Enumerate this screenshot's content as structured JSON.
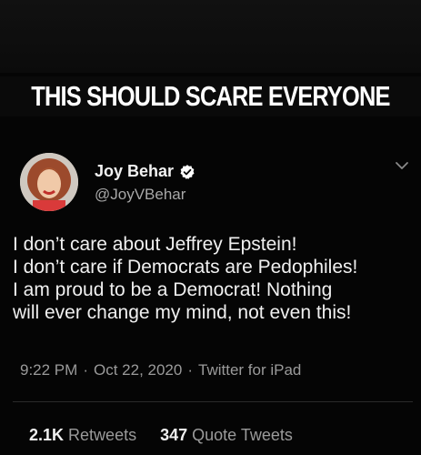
{
  "banner": {
    "text": "THIS SHOULD SCARE EVERYONE"
  },
  "tweet": {
    "display_name": "Joy Behar",
    "handle": "@JoyVBehar",
    "verified_icon": "verified-badge-icon",
    "menu_icon": "chevron-down-icon",
    "lines": [
      "I don’t care about Jeffrey Epstein!",
      "I don’t care if Democrats are Pedophiles!",
      "I am proud to be a Democrat! Nothing",
      "will ever change my mind, not even this!"
    ],
    "time": "9:22 PM",
    "date": "Oct 22, 2020",
    "source": "Twitter for iPad",
    "separator": "·",
    "retweets_count": "2.1K",
    "retweets_label": "Retweets",
    "quote_count": "347",
    "quote_label": "Quote Tweets"
  },
  "colors": {
    "background": "#050505",
    "text_primary": "#f0f0f0",
    "text_secondary": "#9a9a9a"
  }
}
